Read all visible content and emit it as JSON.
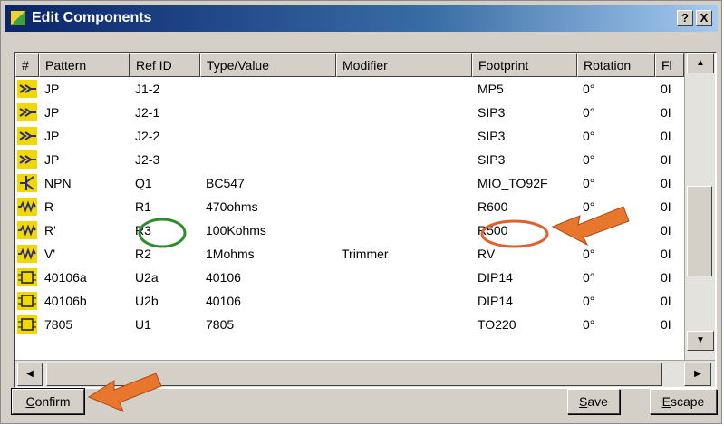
{
  "window": {
    "title": "Edit Components",
    "help_label": "?",
    "close_label": "X"
  },
  "table": {
    "headers": [
      "#",
      "Pattern",
      "Ref ID",
      "Type/Value",
      "Modifier",
      "Footprint",
      "Rotation",
      "Fl"
    ],
    "rows": [
      {
        "icon": "connector-icon",
        "pattern": "JP",
        "ref": "J1-2",
        "value": "",
        "modifier": "",
        "footprint": "MP5",
        "rotation": "0°",
        "flip": "0I"
      },
      {
        "icon": "connector-icon",
        "pattern": "JP",
        "ref": "J2-1",
        "value": "",
        "modifier": "",
        "footprint": "SIP3",
        "rotation": "0°",
        "flip": "0I"
      },
      {
        "icon": "connector-icon",
        "pattern": "JP",
        "ref": "J2-2",
        "value": "",
        "modifier": "",
        "footprint": "SIP3",
        "rotation": "0°",
        "flip": "0I"
      },
      {
        "icon": "connector-icon",
        "pattern": "JP",
        "ref": "J2-3",
        "value": "",
        "modifier": "",
        "footprint": "SIP3",
        "rotation": "0°",
        "flip": "0I"
      },
      {
        "icon": "transistor-icon",
        "pattern": "NPN",
        "ref": "Q1",
        "value": "BC547",
        "modifier": "",
        "footprint": "MIO_TO92F",
        "rotation": "0°",
        "flip": "0I"
      },
      {
        "icon": "resistor-icon",
        "pattern": "R",
        "ref": "R1",
        "value": "470ohms",
        "modifier": "",
        "footprint": "R600",
        "rotation": "0°",
        "flip": "0I"
      },
      {
        "icon": "resistor-icon",
        "pattern": "R'",
        "ref": "R3",
        "value": "100Kohms",
        "modifier": "",
        "footprint": "R500",
        "rotation": "0°",
        "flip": "0I"
      },
      {
        "icon": "resistor-icon",
        "pattern": "V'",
        "ref": "R2",
        "value": "1Mohms",
        "modifier": "Trimmer",
        "footprint": "RV",
        "rotation": "0°",
        "flip": "0I"
      },
      {
        "icon": "ic-chip-icon",
        "pattern": "40106a",
        "ref": "U2a",
        "value": "40106",
        "modifier": "",
        "footprint": "DIP14",
        "rotation": "0°",
        "flip": "0I"
      },
      {
        "icon": "ic-chip-icon",
        "pattern": "40106b",
        "ref": "U2b",
        "value": "40106",
        "modifier": "",
        "footprint": "DIP14",
        "rotation": "0°",
        "flip": "0I"
      },
      {
        "icon": "ic-chip-icon",
        "pattern": "7805",
        "ref": "U1",
        "value": "7805",
        "modifier": "",
        "footprint": "TO220",
        "rotation": "0°",
        "flip": "0I"
      }
    ]
  },
  "buttons": {
    "confirm": {
      "first": "C",
      "rest": "onfirm"
    },
    "save": {
      "first": "S",
      "rest": "ave"
    },
    "escape": {
      "first": "E",
      "rest": "scape"
    }
  },
  "scrollbar": {
    "up": "▲",
    "down": "▼",
    "left": "◀",
    "right": "▶"
  },
  "colors": {
    "icon_bg": "#f0d800",
    "annotation_green": "#2e8b2e",
    "annotation_red": "#e06030",
    "arrow_orange": "#e8762c"
  }
}
